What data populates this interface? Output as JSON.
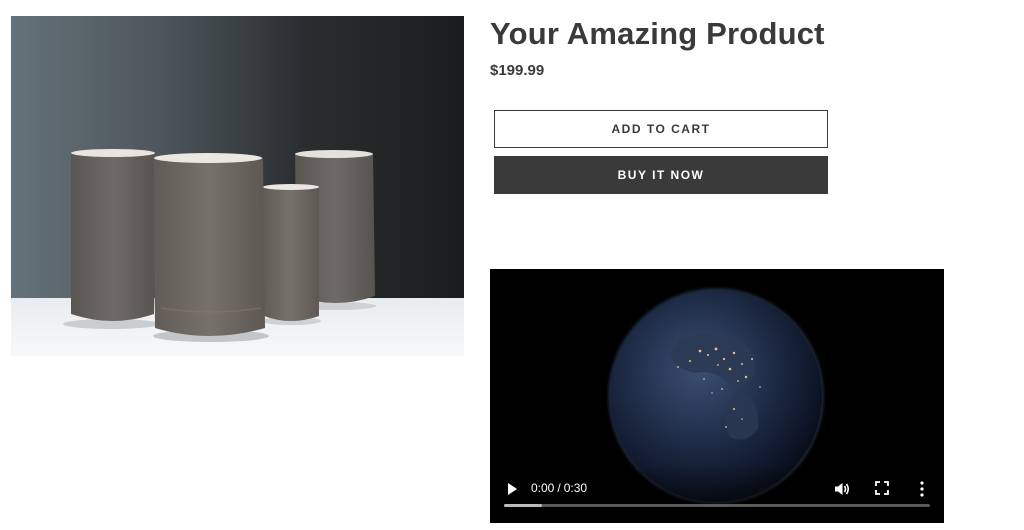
{
  "product": {
    "title": "Your Amazing Product",
    "price": "$199.99",
    "image_icon": "ceramic-vases-image"
  },
  "buttons": {
    "add_to_cart": "ADD TO CART",
    "buy_now": "BUY IT NOW"
  },
  "video": {
    "current_time": "0:00",
    "separator": "/",
    "duration": "0:30",
    "progress_fraction": 0.09,
    "icons": {
      "play": "play-icon",
      "volume": "volume-icon",
      "fullscreen": "fullscreen-icon",
      "more": "more-options-icon"
    }
  },
  "colors": {
    "text": "#3a3a3a",
    "buy_button_bg": "#3a3a3a",
    "video_bg": "#000000"
  }
}
